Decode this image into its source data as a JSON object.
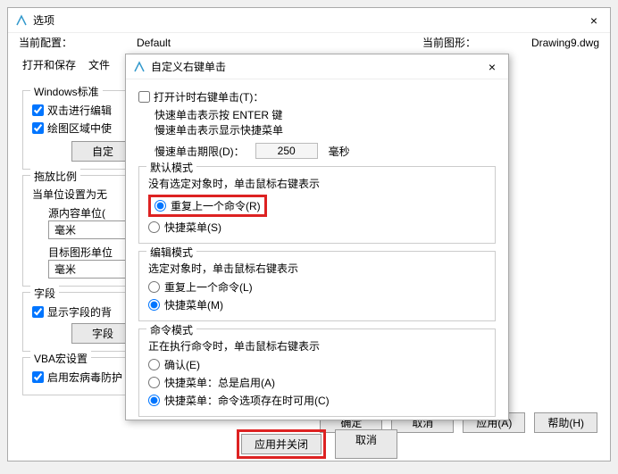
{
  "main": {
    "title": "选项",
    "curConfigLabel": "当前配置：",
    "curConfigValue": "Default",
    "curDrawingLabel": "当前图形：",
    "curDrawingValue": "Drawing9.dwg",
    "tabs": [
      "打开和保存",
      "文件"
    ],
    "groups": {
      "winStd": {
        "title": "Windows标准",
        "chk1": "双击进行编辑",
        "chk2": "绘图区域中使",
        "btn": "自定"
      },
      "scale": {
        "title": "拖放比例",
        "sub": "当单位设置为无",
        "srcLabel": "源内容单位(",
        "srcVal": "毫米",
        "tgtLabel": "目标图形单位",
        "tgtVal": "毫米"
      },
      "field": {
        "title": "字段",
        "chk": "显示字段的背",
        "btn": "字段"
      },
      "vba": {
        "title": "VBA宏设置",
        "chk": "启用宏病毒防护"
      }
    },
    "footer": {
      "ok": "确定",
      "cancel": "取消",
      "apply": "应用(A)",
      "help": "帮助(H)"
    }
  },
  "sub": {
    "title": "自定义右键单击",
    "timer": {
      "chk": "打开计时右键单击(T)：",
      "l1": "快速单击表示按 ENTER 键",
      "l2": "慢速单击表示显示快捷菜单",
      "limLabel": "慢速单击期限(D)：",
      "limVal": "250",
      "limUnit": "毫秒"
    },
    "defMode": {
      "title": "默认模式",
      "desc": "没有选定对象时，单击鼠标右键表示",
      "r1": "重复上一个命令(R)",
      "r2": "快捷菜单(S)"
    },
    "editMode": {
      "title": "编辑模式",
      "desc": "选定对象时，单击鼠标右键表示",
      "r1": "重复上一个命令(L)",
      "r2": "快捷菜单(M)"
    },
    "cmdMode": {
      "title": "命令模式",
      "desc": "正在执行命令时，单击鼠标右键表示",
      "r1": "确认(E)",
      "r2": "快捷菜单：总是启用(A)",
      "r3": "快捷菜单：命令选项存在时可用(C)"
    },
    "footer": {
      "apply": "应用并关闭",
      "cancel": "取消"
    }
  }
}
